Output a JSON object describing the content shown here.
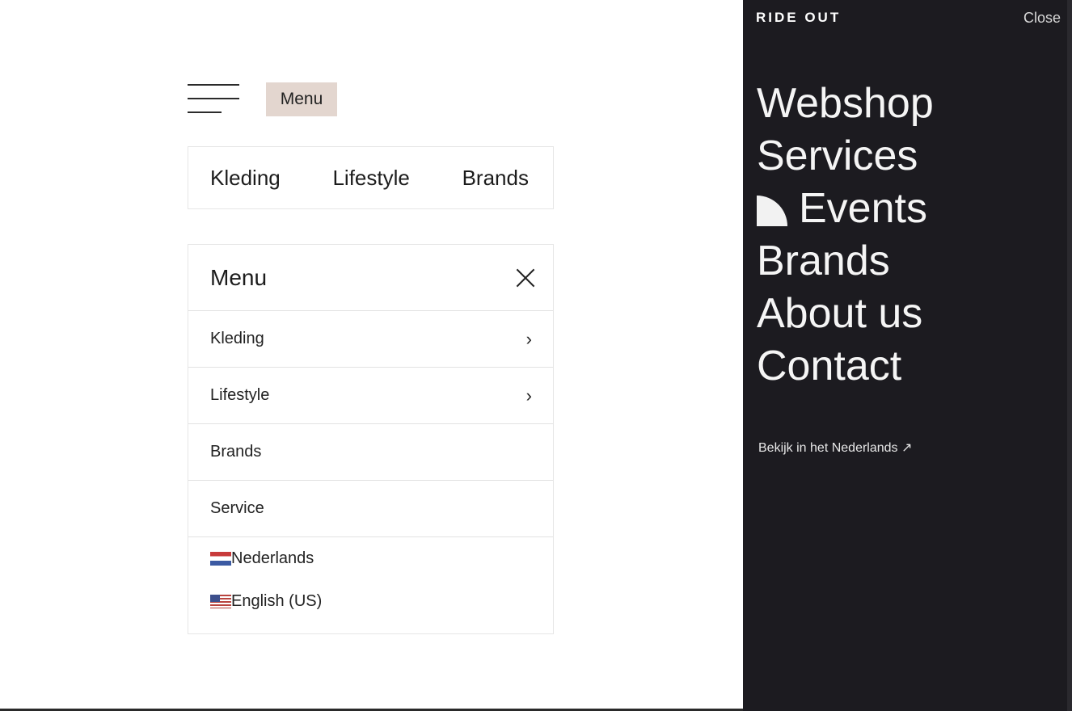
{
  "left_header": {
    "menu_tag_label": "Menu"
  },
  "top_nav": {
    "items": [
      "Kleding",
      "Lifestyle",
      "Brands"
    ]
  },
  "mobile_menu": {
    "title": "Menu",
    "rows": [
      {
        "label": "Kleding",
        "has_chevron": true
      },
      {
        "label": "Lifestyle",
        "has_chevron": true
      },
      {
        "label": "Brands",
        "has_chevron": false
      },
      {
        "label": "Service",
        "has_chevron": false
      }
    ],
    "chevron_glyph": "›",
    "languages": [
      {
        "label": "Nederlands",
        "flag": "nl-flag-icon"
      },
      {
        "label": "English (US)",
        "flag": "us-flag-icon"
      }
    ]
  },
  "side_menu": {
    "brand": "RIDE OUT",
    "close_label": "Close",
    "items": [
      "Webshop",
      "Services",
      "Events",
      "Brands",
      "About us",
      "Contact"
    ],
    "language_link": "Bekijk in het Nederlands ↗",
    "background_color": "#1c1b20",
    "accent_tag_color": "#e3d6cf"
  }
}
